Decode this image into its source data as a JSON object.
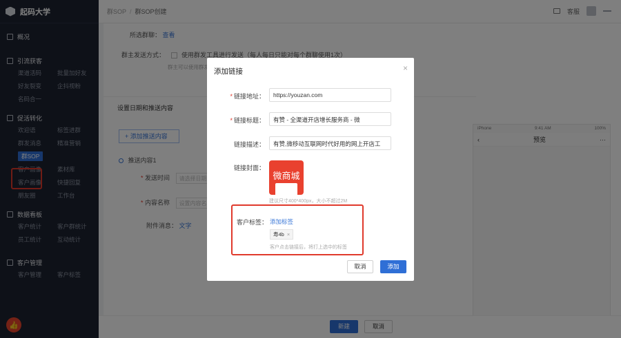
{
  "brand": {
    "name": "起码大学"
  },
  "sidebar": {
    "overview": "概况",
    "sections": [
      {
        "title": "引流获客",
        "items": [
          "渠道活码",
          "批量加好友",
          "好友裂变",
          "企抖视粉",
          "名码合一"
        ]
      },
      {
        "title": "促活转化",
        "items": [
          "欢迎语",
          "标签进群",
          "群发消息",
          "精准营销",
          "群SOP",
          "",
          "客户画像",
          "素材库",
          "客户画像",
          "快捷回复",
          "朋友圈",
          "工作台"
        ]
      },
      {
        "title": "数据看板",
        "items": [
          "客户统计",
          "客户群统计",
          "员工统计",
          "互动统计"
        ]
      },
      {
        "title": "客户管理",
        "items": [
          "客户管理",
          "客户标签"
        ]
      }
    ],
    "active_item": "群SOP"
  },
  "topbar": {
    "crumb1": "群SOP",
    "crumb_sep": "/",
    "crumb2": "群SOP创建",
    "customer_service": "客服"
  },
  "form": {
    "selected_group_label": "所选群聊：",
    "selected_group_link": "查看",
    "send_mode_label": "群主发送方式：",
    "send_mode_option": "使用群发工具进行发送（每人每日只能对每个群聊使用1次）",
    "send_mode_hint": "群主可以使用群发",
    "push_section_title": "设置日期和推送内容",
    "add_push_button": "+  添加推送内容",
    "push_item_title": "推送内容1",
    "send_time_label": "发送时间",
    "send_time_placeholder": "请选择日期",
    "content_name_label": "内容名称",
    "content_name_placeholder": "设置内容名称",
    "attachment_label": "附件消息：",
    "attachment_text": "文字"
  },
  "phone": {
    "status_left": "iPhone",
    "status_time": "9:41 AM",
    "status_right": "100%",
    "title": "预览"
  },
  "bottom": {
    "create_button": "新建",
    "cancel_button": "取消"
  },
  "modal": {
    "title": "添加链接",
    "close": "×",
    "url_label": "链接地址",
    "url_value": "https://youzan.com",
    "title_label": "链接标题",
    "title_value": "有赞 - 全渠道开店增长服务商 - 微",
    "desc_label": "链接描述",
    "desc_value": "有赞,微移动互联网时代好用的网上开店工",
    "cover_label": "链接封面",
    "cover_text": "微商城",
    "cover_hint": "建议尺寸400*400px，大小不超过2M",
    "tag_label": "客户标签",
    "tag_add": "添加标签",
    "tag_chip": "寿4b",
    "tag_chip_x": "×",
    "tag_hint": "客户点击链接后，将打上选中的标签",
    "cancel_button": "取消",
    "ok_button": "添加"
  }
}
